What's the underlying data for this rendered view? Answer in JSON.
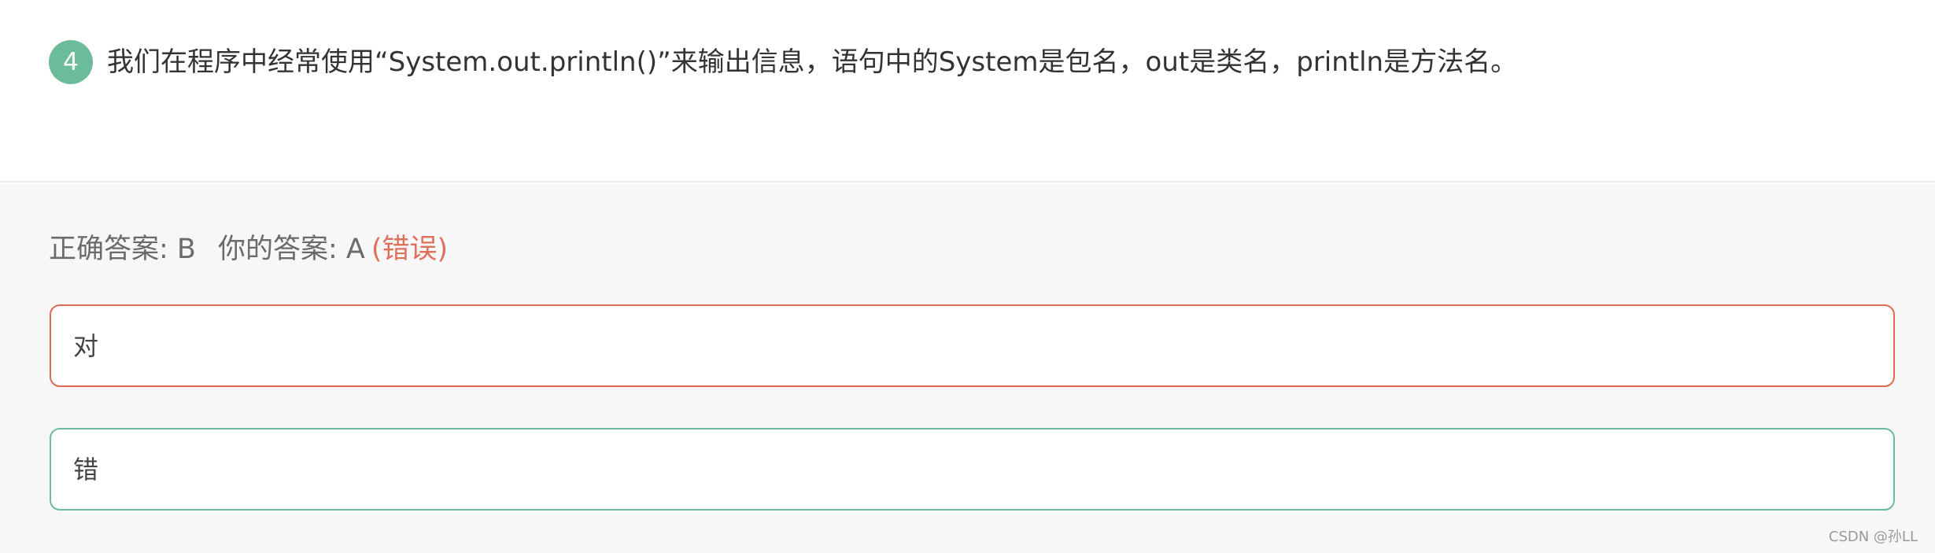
{
  "question": {
    "number": "4",
    "text": "我们在程序中经常使用“System.out.println()”来输出信息，语句中的System是包名，out是类名，println是方法名。"
  },
  "result": {
    "correct_label": "正确答案: B",
    "your_label": "你的答案: A",
    "status": "(错误)"
  },
  "options": [
    {
      "label": "对"
    },
    {
      "label": "错"
    }
  ],
  "watermark": "CSDN @孙LL",
  "colors": {
    "accent_green": "#6cbb9a",
    "error_red": "#de6a52"
  }
}
